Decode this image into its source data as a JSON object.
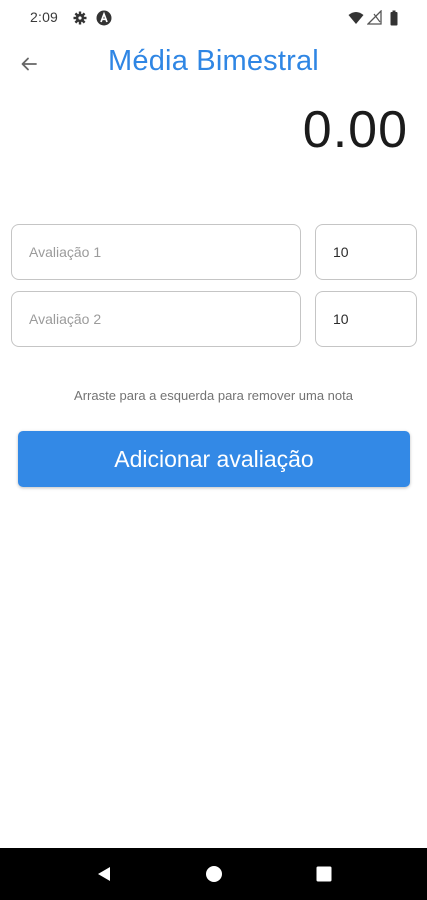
{
  "status_bar": {
    "time": "2:09",
    "icons": [
      "gear-icon",
      "a-icon",
      "wifi-icon",
      "signal-icon",
      "battery-icon"
    ]
  },
  "app_bar": {
    "back_icon": "arrow-left-icon",
    "title": "Média Bimestral"
  },
  "average": "0.00",
  "grades": [
    {
      "name_placeholder": "Avaliação 1",
      "weight": "10"
    },
    {
      "name_placeholder": "Avaliação 2",
      "weight": "10"
    }
  ],
  "hint": "Arraste para a esquerda para remover uma nota",
  "add_button_label": "Adicionar avaliação",
  "nav_bar": {
    "icons": [
      "back-triangle-icon",
      "home-circle-icon",
      "recents-square-icon"
    ]
  },
  "colors": {
    "accent": "#2f86e4",
    "button": "#3389e6",
    "border": "#c5c5c5"
  }
}
